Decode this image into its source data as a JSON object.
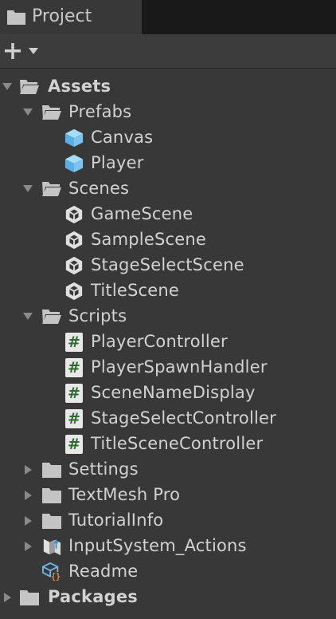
{
  "tab": {
    "label": "Project",
    "icon": "folder-icon"
  },
  "toolbar": {
    "add_icon": "plus-icon",
    "dropdown_icon": "caret-down-icon"
  },
  "tree": {
    "assets": "Assets",
    "prefabs": "Prefabs",
    "canvas": "Canvas",
    "player": "Player",
    "scenes": "Scenes",
    "game_scene": "GameScene",
    "sample_scene": "SampleScene",
    "stage_select_scene": "StageSelectScene",
    "title_scene": "TitleScene",
    "scripts": "Scripts",
    "player_controller": "PlayerController",
    "player_spawn_handler": "PlayerSpawnHandler",
    "scene_name_display": "SceneNameDisplay",
    "stage_select_controller": "StageSelectController",
    "title_scene_controller": "TitleSceneController",
    "settings": "Settings",
    "textmesh_pro": "TextMesh Pro",
    "tutorial_info": "TutorialInfo",
    "input_system_actions": "InputSystem_Actions",
    "readme": "Readme",
    "packages": "Packages"
  },
  "colors": {
    "panel_bg": "#383838",
    "tab_strip_bg": "#191919",
    "text": "#d2d2d2",
    "prefab_blue": "#7cc4f0",
    "script_green": "#2e6b2e"
  }
}
